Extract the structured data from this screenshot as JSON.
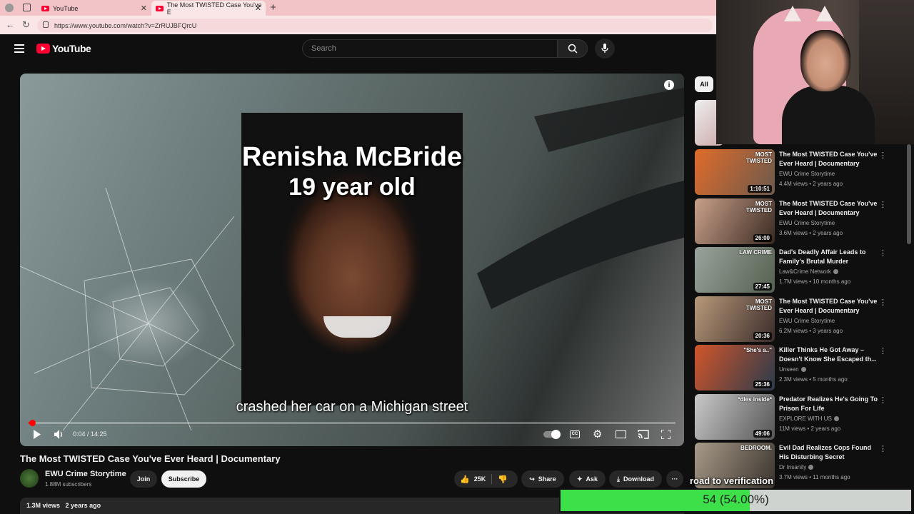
{
  "browser": {
    "tabs": [
      {
        "label": "YouTube"
      },
      {
        "label": "The Most TWISTED Case You've E"
      }
    ],
    "new_tab_glyph": "+",
    "close_glyph": "✕",
    "url": "https://www.youtube.com/watch?v=ZrRUJBFQrcU"
  },
  "header": {
    "logo_text": "YouTube",
    "search_placeholder": "Search"
  },
  "player": {
    "overlay_name": "Renisha McBride",
    "overlay_age": "19 year old",
    "caption": "crashed her car on a Michigan street",
    "time": "0:04 / 14:25",
    "progress": 0.005
  },
  "video": {
    "title": "The Most TWISTED Case You've Ever Heard | Documentary",
    "channel": "EWU Crime Storytime",
    "subscribers": "1.88M subscribers",
    "join_label": "Join",
    "subscribe_label": "Subscribe",
    "likes": "25K",
    "share_label": "Share",
    "ask_label": "Ask",
    "download_label": "Download",
    "more_label": "···",
    "views": "1.3M views",
    "age": "2 years ago"
  },
  "sidebar": {
    "chip": "All",
    "recommendations": [
      {
        "title": "The Most TWISTED Case You've Ever Heard | Documentary",
        "channel": "EWU Crime Storytime",
        "views": "4.4M views",
        "age": "2 years ago",
        "duration": "1:10:51",
        "thumb_text": "MOST TWISTED",
        "verified": false,
        "colors": [
          "#e06b2a",
          "#6b5a4d"
        ]
      },
      {
        "title": "The Most TWISTED Case You've Ever Heard | Documentary",
        "channel": "EWU Crime Storytime",
        "views": "3.6M views",
        "age": "2 years ago",
        "duration": "26:00",
        "thumb_text": "MOST TWISTED",
        "verified": false,
        "colors": [
          "#c9a08a",
          "#3a2a22"
        ]
      },
      {
        "title": "Dad's Deadly Affair Leads to Family's Brutal Murder",
        "channel": "Law&Crime Network",
        "views": "1.7M views",
        "age": "10 months ago",
        "duration": "27:45",
        "thumb_text": "LAW CRIME",
        "verified": true,
        "colors": [
          "#9aa39c",
          "#54604f"
        ]
      },
      {
        "title": "The Most TWISTED Case You've Ever Heard | Documentary",
        "channel": "EWU Crime Storytime",
        "views": "6.2M views",
        "age": "3 years ago",
        "duration": "20:36",
        "thumb_text": "MOST TWISTED",
        "verified": false,
        "colors": [
          "#b89a7a",
          "#3b2b2a"
        ]
      },
      {
        "title": "Killer Thinks He Got Away – Doesn't Know She Escaped th...",
        "channel": "Unseen",
        "views": "2.3M views",
        "age": "5 months ago",
        "duration": "25:36",
        "thumb_text": "\"She's a..\"",
        "verified": true,
        "colors": [
          "#d2552a",
          "#2a3b4c"
        ]
      },
      {
        "title": "Predator Realizes He's Going To Prison For Life",
        "channel": "EXPLORE WITH US",
        "views": "11M views",
        "age": "2 years ago",
        "duration": "49:06",
        "thumb_text": "*dies inside*",
        "verified": true,
        "colors": [
          "#c9c9c9",
          "#555"
        ]
      },
      {
        "title": "Evil Dad Realizes Cops Found His Disturbing Secret",
        "channel": "Dr Insanity",
        "views": "3.7M views",
        "age": "11 months ago",
        "duration": "",
        "thumb_text": "BEDROOM.",
        "verified": true,
        "colors": [
          "#a89a88",
          "#3a342e"
        ]
      }
    ]
  },
  "stream_overlay": {
    "goal_label": "road to verification",
    "goal_text": "54 (54.00%)",
    "goal_fraction": 0.54,
    "bar_color": "#3ee04a"
  }
}
